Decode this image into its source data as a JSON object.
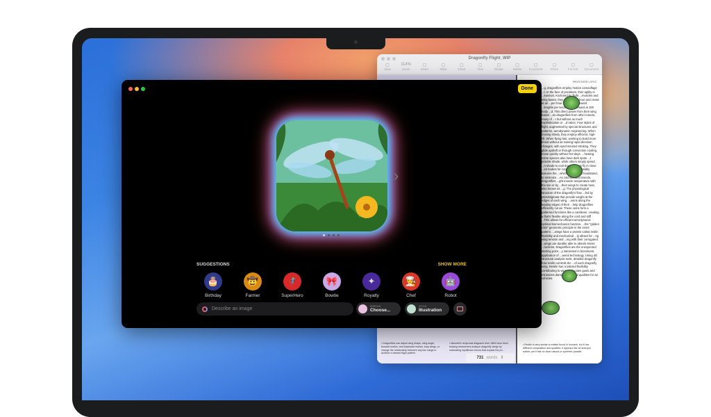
{
  "document": {
    "title": "Dragonfly Flight_WIP",
    "zoom": "114%",
    "toolbar": [
      "View",
      "Zoom",
      "Insert",
      "Table",
      "Chart",
      "Text",
      "Shape",
      "Media",
      "Comment",
      "Share",
      "Format",
      "Document"
    ],
    "header": "PROFESSOR LOPEZ",
    "body": "...g, dragonflies employ motion camouflage ...t. In the face of predators, their agility is ...survival. Anchored by flight ...muscles and wing bases, they ...miles per hour and cruise at an ...per hour. They fly backward ...lengths per second and forward at 100 body ...d. This direct power from their wing bases ...es dragonflies from other insects, many of ...r but without as much sophistication or ...d ration. Four styles of flight, augmented by special structures and patterns, aerodynamic engineering. When moving slowly, they employ efficient, high-lift. When flying fast, working to build more thrust without as making rapid direction changes, with synchronized stroking. They glide updraft or through convection cooling, move quickly without hot days. ...heating, some species also have dark spots ...t provide shade, while others simply spend ...n shade to cool down. Others fly in close ...eir bodies for cooling. Many notably assume the ...which looks like a handstand, to minimize ...As cold-blooded insects, dragonflies ...ght muscle temperature with the sun or by ...their wings to create heat, also known as ...g. The physiological structure of the dragonfly's flow ...fed by pterostigmata that provide weight at the edges of each wing. ...veins along the leading edges of their ...help dragonflies efficiently cut air. These veins form a patterned functions like a cantilever, creating a that's flexible along the cord and stiff ...This allows for efficient aerodynamic optimal biomechanics function. ...the \"golden ratio\" geometric principle in the veins' pattern. ...wings have a protein called resilin flexibility and mechanical ...ly allows for ...ng wing tension and ...ing with their corrugated ...wings are durable able to absorb stress ...ructions. Dragonflies are the unexpected starting point ...y interested in biomimetic application of ...aerial technology. Using 4D structural analysis tools, detailed dragonfly how resilin controls the ...of each dragonfly wing. Resilin has a tailored flexibility contributing to wing ...allocates gusts and minimizes damage—...ential qualities for air vehicles.",
    "footnotes": [
      "• Dragonflies can adjust wing shape, wing angle, forward motion, and backward motion, stop wings, or change the relationship between any two wings to achieve a desired flight pattern.",
      "• Maxwell's reciprocal diagrams from 1864 have been helping researchers analyze dragonfly wings by calculating equilibrium forces that explain the ph...",
      "• Resilin is very similar to elastin found in humans, but it has different composition and qualities. It appears like an isotropic rubber, yet it has no clear natural or synthetic parallel."
    ],
    "word_count": "731",
    "word_label": "words"
  },
  "playground": {
    "done_label": "Done",
    "suggestions_label": "SUGGESTIONS",
    "show_more_label": "SHOW MORE",
    "suggestions": [
      {
        "label": "Birthday",
        "icon": "cake-icon",
        "color": "#2f3a8a"
      },
      {
        "label": "Farmer",
        "icon": "hat-icon",
        "color": "#d98a10"
      },
      {
        "label": "SuperHero",
        "icon": "hero-icon",
        "color": "#d8282a"
      },
      {
        "label": "Bowtie",
        "icon": "bowtie-icon",
        "color": "#c9a8e8"
      },
      {
        "label": "Royalty",
        "icon": "scepter-icon",
        "color": "#4a2a9a"
      },
      {
        "label": "Chef",
        "icon": "chef-hat-icon",
        "color": "#d8382a"
      },
      {
        "label": "Robot",
        "icon": "robot-icon",
        "color": "#9a4ad8"
      }
    ],
    "prompt_placeholder": "Describe an image",
    "person": {
      "label": "PERSON",
      "value": "Choose..."
    },
    "style": {
      "label": "STYLE",
      "value": "Illustration"
    },
    "page_count": 4,
    "current_page": 1
  },
  "colors": {
    "accent": "#f5d10a"
  }
}
